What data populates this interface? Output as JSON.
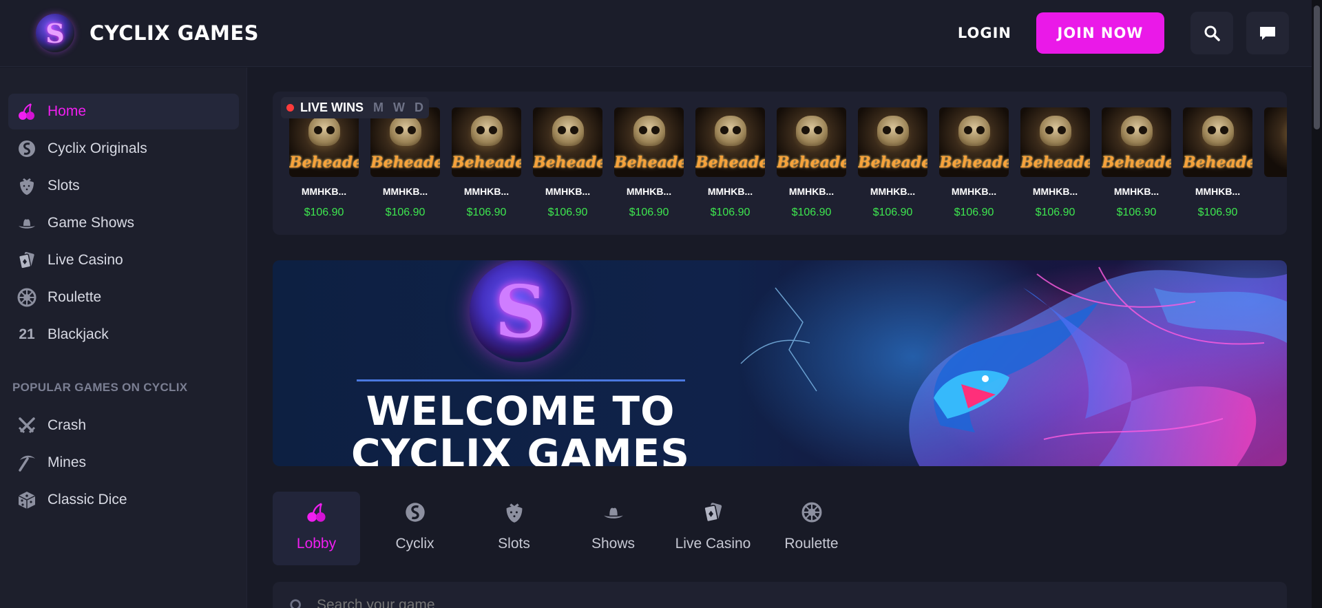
{
  "header": {
    "brand_name": "CYCLIX GAMES",
    "login_label": "LOGIN",
    "join_label": "JOIN NOW",
    "accent": "#ea19e8"
  },
  "sidebar": {
    "items": [
      {
        "label": "Home",
        "icon": "cherries-icon",
        "active": true
      },
      {
        "label": "Cyclix Originals",
        "icon": "dragon-icon"
      },
      {
        "label": "Slots",
        "icon": "strawberry-icon"
      },
      {
        "label": "Game Shows",
        "icon": "cowboy-hat-icon"
      },
      {
        "label": "Live Casino",
        "icon": "cards-icon"
      },
      {
        "label": "Roulette",
        "icon": "roulette-icon"
      },
      {
        "label": "Blackjack",
        "icon": "blackjack-21-icon",
        "icon_text": "21"
      }
    ],
    "popular_heading": "POPULAR GAMES ON CYCLIX",
    "popular": [
      {
        "label": "Crash",
        "icon": "crossed-swords-icon"
      },
      {
        "label": "Mines",
        "icon": "pickaxe-icon"
      },
      {
        "label": "Classic Dice",
        "icon": "dice-icon"
      }
    ]
  },
  "live_wins": {
    "title": "LIVE WINS",
    "tabs": [
      "M",
      "W",
      "D"
    ],
    "wins": [
      {
        "game": "Beheaded",
        "user": "MMHKB...",
        "amount": "$106.90"
      },
      {
        "game": "Beheaded",
        "user": "MMHKB...",
        "amount": "$106.90"
      },
      {
        "game": "Beheaded",
        "user": "MMHKB...",
        "amount": "$106.90"
      },
      {
        "game": "Beheaded",
        "user": "MMHKB...",
        "amount": "$106.90"
      },
      {
        "game": "Beheaded",
        "user": "MMHKB...",
        "amount": "$106.90"
      },
      {
        "game": "Beheaded",
        "user": "MMHKB...",
        "amount": "$106.90"
      },
      {
        "game": "Beheaded",
        "user": "MMHKB...",
        "amount": "$106.90"
      },
      {
        "game": "Beheaded",
        "user": "MMHKB...",
        "amount": "$106.90"
      },
      {
        "game": "Beheaded",
        "user": "MMHKB...",
        "amount": "$106.90"
      },
      {
        "game": "Beheaded",
        "user": "MMHKB...",
        "amount": "$106.90"
      },
      {
        "game": "Beheaded",
        "user": "MMHKB...",
        "amount": "$106.90"
      },
      {
        "game": "Beheaded",
        "user": "MMHKB...",
        "amount": "$106.90"
      }
    ]
  },
  "banner": {
    "title_line1": "WELCOME TO",
    "title_line2": "CYCLIX GAMES",
    "logo_letter": "S"
  },
  "categories": [
    {
      "label": "Lobby",
      "icon": "cherries-icon",
      "active": true
    },
    {
      "label": "Cyclix",
      "icon": "dragon-icon"
    },
    {
      "label": "Slots",
      "icon": "strawberry-icon"
    },
    {
      "label": "Shows",
      "icon": "cowboy-hat-icon"
    },
    {
      "label": "Live Casino",
      "icon": "cards-icon"
    },
    {
      "label": "Roulette",
      "icon": "roulette-icon"
    }
  ],
  "search": {
    "placeholder": "Search your game"
  }
}
